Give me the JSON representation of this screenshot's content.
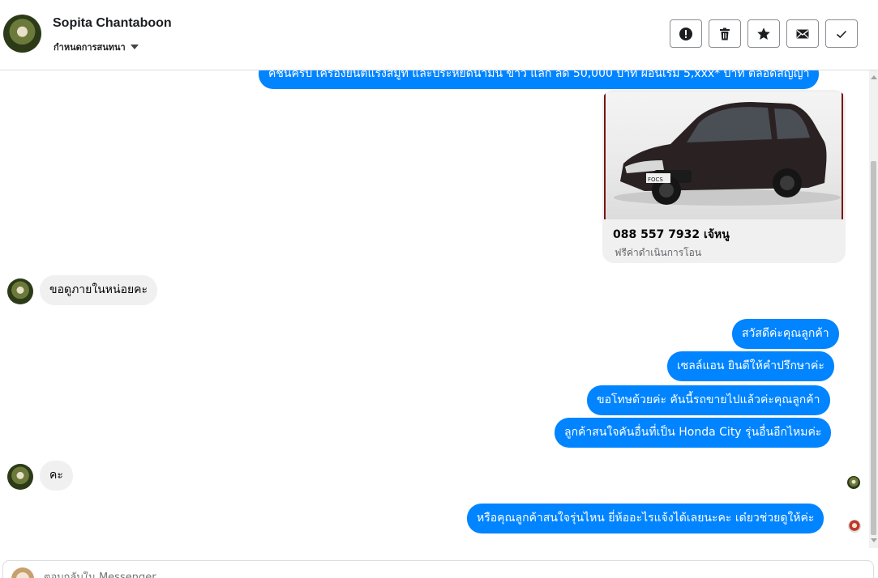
{
  "header": {
    "contact_name": "Sopita Chantaboon",
    "subtitle": "กำหนดการสนทนา",
    "actions": [
      {
        "icon": "alert-icon",
        "label": "spam"
      },
      {
        "icon": "trash-icon",
        "label": "delete"
      },
      {
        "icon": "star-icon",
        "label": "star"
      },
      {
        "icon": "envelope-icon",
        "label": "mark unread"
      },
      {
        "icon": "check-icon",
        "label": "done"
      }
    ]
  },
  "messages": {
    "top_cut": "คชันครับ เครื่องยนต์แรงสมูท และประหยัดน้ำมัน ขาว แลก ลด 50,000 บาท ผ่อนเริ่ม 5,xxx* บาท ตลอดสัญญา",
    "card": {
      "title": "088 557 7932 เจ้หนู",
      "subtitle": "ฟรีค่าดำเนินการโอน",
      "car_plate": "FOCS"
    },
    "in_1": "ขอดูภายในหน่อยคะ",
    "out_1": "สวัสดีค่ะคุณลูกค้า",
    "out_2": "เซลล์แอน ยินดีให้คำปรึกษาค่ะ",
    "out_3": "ขอโทษด้วยค่ะ คันนี้รถขายไปแล้วค่ะคุณลูกค้า",
    "out_4": "ลูกค้าสนใจคันอื่นที่เป็น Honda City รุ่นอื่นอีกไหมค่ะ",
    "in_2": "คะ",
    "out_5": "หรือคุณลูกค้าสนใจรุ่นไหน ยี่ห้ออะไรแจ้งได้เลยนะคะ เด๋ยวช่วยดูให้ค่ะ"
  },
  "composer": {
    "placeholder": "ตอบกลับใน Messenger..."
  },
  "colors": {
    "outgoing": "#0084ff",
    "incoming": "#f0f0f0",
    "car_body": "#2a2222"
  }
}
